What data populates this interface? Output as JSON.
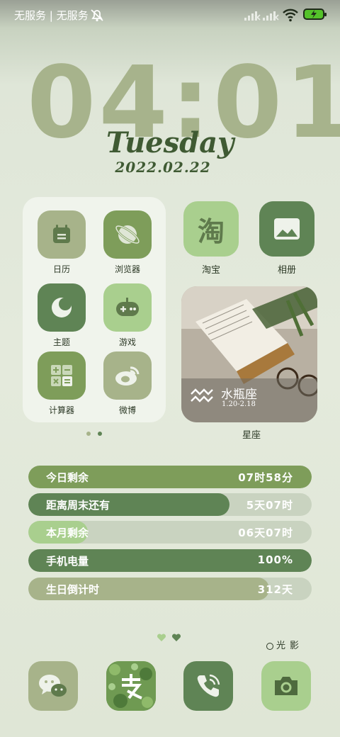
{
  "status_bar": {
    "carrier": "无服务 | 无服务",
    "battery_color": "#54c22a",
    "icons": [
      "bell-off-icon",
      "signal-icon",
      "signal-icon",
      "wifi-icon",
      "battery-icon"
    ]
  },
  "clock": {
    "time": "04:01",
    "weekday": "Tuesday",
    "date": "2022.02.22"
  },
  "folder": {
    "apps": [
      {
        "label": "日历",
        "icon": "calendar-icon"
      },
      {
        "label": "浏览器",
        "icon": "browser-icon"
      },
      {
        "label": "主题",
        "icon": "theme-icon"
      },
      {
        "label": "游戏",
        "icon": "gamepad-icon"
      },
      {
        "label": "计算器",
        "icon": "calculator-icon"
      },
      {
        "label": "微博",
        "icon": "weibo-icon"
      }
    ]
  },
  "apps": {
    "taobao": {
      "label": "淘宝",
      "glyph": "淘"
    },
    "gallery": {
      "label": "相册",
      "icon": "image-icon"
    }
  },
  "photo_widget": {
    "sign": "水瓶座",
    "range": "1.20-2.18",
    "label": "星座"
  },
  "progress": [
    {
      "label": "今日剩余",
      "value": "07时58分",
      "fraction": 1.0,
      "color": "#7e9d5a"
    },
    {
      "label": "距离周末还有",
      "value": "5天07时",
      "fraction": 0.71,
      "color": "#5f8455"
    },
    {
      "label": "本月剩余",
      "value": "06天07时",
      "fraction": 0.21,
      "color": "#a9cf8e"
    },
    {
      "label": "手机电量",
      "value": "100%",
      "fraction": 1.0,
      "color": "#5f8455"
    },
    {
      "label": "生日倒计时",
      "value": "312天",
      "fraction": 0.85,
      "color": "#a7b38a"
    }
  ],
  "light_shadow": "光影",
  "dock": [
    {
      "name": "wechat",
      "icon": "chat-bubbles-icon"
    },
    {
      "name": "alipay",
      "icon": "alipay-icon"
    },
    {
      "name": "phone",
      "icon": "phone-icon"
    },
    {
      "name": "camera",
      "icon": "camera-icon"
    }
  ]
}
